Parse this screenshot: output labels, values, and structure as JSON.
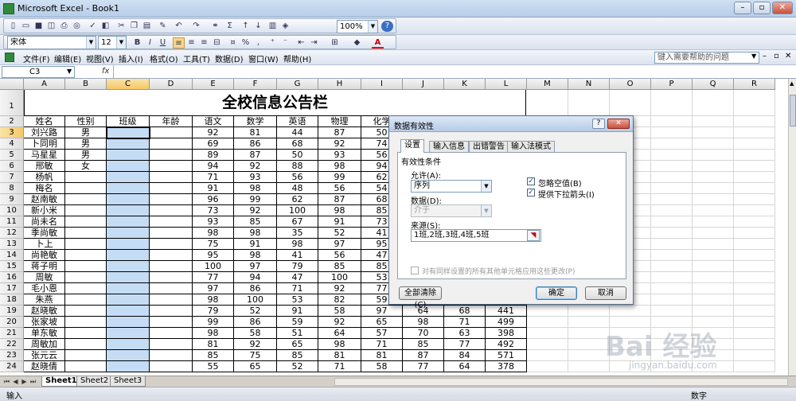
{
  "app": {
    "title": "Microsoft Excel - Book1"
  },
  "toolbar": {
    "zoom": "100%",
    "font": "宋体",
    "font_size": "12",
    "bold": "B",
    "italic": "I",
    "underline": "U",
    "percent": "%"
  },
  "menu": [
    "文件(F)",
    "编辑(E)",
    "视图(V)",
    "插入(I)",
    "格式(O)",
    "工具(T)",
    "数据(D)",
    "窗口(W)",
    "帮助(H)"
  ],
  "help_box": "键入需要帮助的问题",
  "formula_bar": {
    "name_box": "C3",
    "fx": "fx",
    "content": ""
  },
  "sheet": {
    "columns": [
      "A",
      "B",
      "C",
      "D",
      "E",
      "F",
      "G",
      "H",
      "I",
      "J",
      "K",
      "L",
      "M",
      "N",
      "O",
      "P",
      "Q",
      "R"
    ],
    "title": "全校信息公告栏",
    "headers": [
      "姓名",
      "性别",
      "班级",
      "年龄",
      "语文",
      "数学",
      "英语",
      "物理",
      "化学"
    ],
    "rows": [
      {
        "n": "3",
        "c": [
          "刘兴路",
          "男",
          "",
          "",
          "92",
          "81",
          "44",
          "87",
          "50",
          "",
          "",
          ""
        ]
      },
      {
        "n": "4",
        "c": [
          "卜同明",
          "男",
          "",
          "",
          "69",
          "86",
          "68",
          "92",
          "74",
          "",
          "",
          ""
        ]
      },
      {
        "n": "5",
        "c": [
          "马星星",
          "男",
          "",
          "",
          "89",
          "87",
          "50",
          "93",
          "56",
          "",
          "",
          ""
        ]
      },
      {
        "n": "6",
        "c": [
          "邢敏",
          "女",
          "",
          "",
          "94",
          "92",
          "88",
          "98",
          "94",
          "",
          "",
          ""
        ]
      },
      {
        "n": "7",
        "c": [
          "杨帆",
          "",
          "",
          "",
          "71",
          "93",
          "56",
          "99",
          "62",
          "",
          "",
          ""
        ]
      },
      {
        "n": "8",
        "c": [
          "梅名",
          "",
          "",
          "",
          "91",
          "98",
          "48",
          "56",
          "54",
          "",
          "",
          ""
        ]
      },
      {
        "n": "9",
        "c": [
          "赵南敏",
          "",
          "",
          "",
          "96",
          "99",
          "62",
          "87",
          "68",
          "",
          "",
          ""
        ]
      },
      {
        "n": "10",
        "c": [
          "新小米",
          "",
          "",
          "",
          "73",
          "92",
          "100",
          "98",
          "85",
          "",
          "",
          ""
        ]
      },
      {
        "n": "11",
        "c": [
          "尚未名",
          "",
          "",
          "",
          "93",
          "85",
          "67",
          "91",
          "73",
          "",
          "",
          ""
        ]
      },
      {
        "n": "12",
        "c": [
          "季尚敏",
          "",
          "",
          "",
          "98",
          "98",
          "35",
          "52",
          "41",
          "",
          "",
          ""
        ]
      },
      {
        "n": "13",
        "c": [
          "卜上",
          "",
          "",
          "",
          "75",
          "91",
          "98",
          "97",
          "95",
          "",
          "",
          ""
        ]
      },
      {
        "n": "14",
        "c": [
          "尚艳敏",
          "",
          "",
          "",
          "95",
          "98",
          "41",
          "56",
          "47",
          "",
          "",
          ""
        ]
      },
      {
        "n": "15",
        "c": [
          "蒋子明",
          "",
          "",
          "",
          "100",
          "97",
          "79",
          "85",
          "85",
          "",
          "",
          ""
        ]
      },
      {
        "n": "16",
        "c": [
          "周敏",
          "",
          "",
          "",
          "77",
          "94",
          "47",
          "100",
          "53",
          "",
          "",
          ""
        ]
      },
      {
        "n": "17",
        "c": [
          "毛小恩",
          "",
          "",
          "",
          "97",
          "86",
          "71",
          "92",
          "77",
          "",
          "",
          ""
        ]
      },
      {
        "n": "18",
        "c": [
          "朱燕",
          "",
          "",
          "",
          "98",
          "100",
          "53",
          "82",
          "59",
          "",
          "",
          ""
        ]
      },
      {
        "n": "19",
        "c": [
          "赵晓敏",
          "",
          "",
          "",
          "79",
          "52",
          "91",
          "58",
          "97",
          "64",
          "68",
          "441"
        ]
      },
      {
        "n": "20",
        "c": [
          "张家坡",
          "",
          "",
          "",
          "99",
          "86",
          "59",
          "92",
          "65",
          "98",
          "71",
          "499"
        ]
      },
      {
        "n": "21",
        "c": [
          "单东敏",
          "",
          "",
          "",
          "98",
          "58",
          "51",
          "64",
          "57",
          "70",
          "63",
          "398"
        ]
      },
      {
        "n": "22",
        "c": [
          "周敏加",
          "",
          "",
          "",
          "81",
          "92",
          "65",
          "98",
          "71",
          "85",
          "77",
          "492"
        ]
      },
      {
        "n": "23",
        "c": [
          "张元云",
          "",
          "",
          "",
          "85",
          "75",
          "85",
          "81",
          "81",
          "87",
          "84",
          "571"
        ]
      },
      {
        "n": "24",
        "c": [
          "赵晓倩",
          "",
          "",
          "",
          "55",
          "65",
          "52",
          "71",
          "58",
          "77",
          "64",
          "378"
        ]
      }
    ],
    "tabs": [
      "Sheet1",
      "Sheet2",
      "Sheet3"
    ]
  },
  "status": {
    "left": "输入",
    "right": "数字"
  },
  "dialog": {
    "title": "数据有效性",
    "tabs": [
      "设置",
      "输入信息",
      "出错警告",
      "输入法模式"
    ],
    "section": "有效性条件",
    "allow_label": "允许(A):",
    "allow_value": "序列",
    "data_label": "数据(D):",
    "data_value": "介于",
    "ignore_blank": "忽略空值(B)",
    "dropdown_arrow": "提供下拉箭头(I)",
    "source_label": "来源(S):",
    "source_value": "1班,2班,3班,4班,5班",
    "apply_all": "对有同样设置的所有其他单元格应用这些更改(P)",
    "clear_all": "全部清除(C)",
    "ok": "确定",
    "cancel": "取消"
  },
  "watermark": {
    "main": "Bai 经验",
    "sub": "jingyan.baidu.com"
  }
}
